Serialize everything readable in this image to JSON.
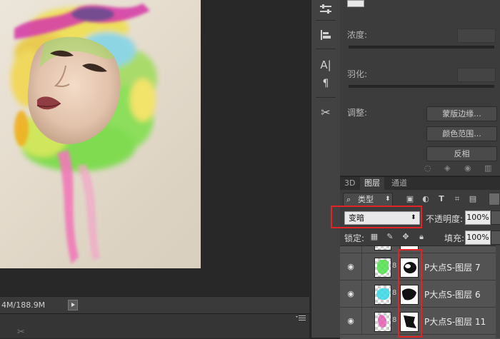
{
  "status_bar": {
    "doc_size": "4M/188.9M"
  },
  "toolbar": {
    "tools": [
      "adjust-sliders-icon",
      "align-stack-icon",
      "character-icon",
      "paragraph-icon",
      "tools-cross-icon"
    ]
  },
  "properties": {
    "density_label": "浓度:",
    "feather_label": "羽化:",
    "refine_label": "调整:",
    "buttons": {
      "mask_edge": "蒙版边缘...",
      "color_range": "颜色范围...",
      "invert": "反相"
    }
  },
  "layers_panel": {
    "tabs": [
      {
        "label": "3D",
        "active": false
      },
      {
        "label": "图层",
        "active": true
      },
      {
        "label": "通道",
        "active": false
      }
    ],
    "filter": {
      "kind_label": "类型"
    },
    "blend_mode": "变暗",
    "opacity_label": "不透明度:",
    "opacity_value": "100%",
    "lock_label": "锁定:",
    "fill_label": "填充:",
    "fill_value": "100%",
    "layers": [
      {
        "name": "P大点S-图层 7",
        "thumb_color": "#4fe24a",
        "visible": true
      },
      {
        "name": "P大点S-图层 6",
        "thumb_color": "#35d8e6",
        "visible": true
      },
      {
        "name": "P大点S-图层 11",
        "thumb_color": "#e455b0",
        "visible": true
      }
    ]
  },
  "colors": {
    "highlight": "#e42424",
    "panel_bg": "#3c3c3c",
    "canvas_bg": "#282828"
  }
}
